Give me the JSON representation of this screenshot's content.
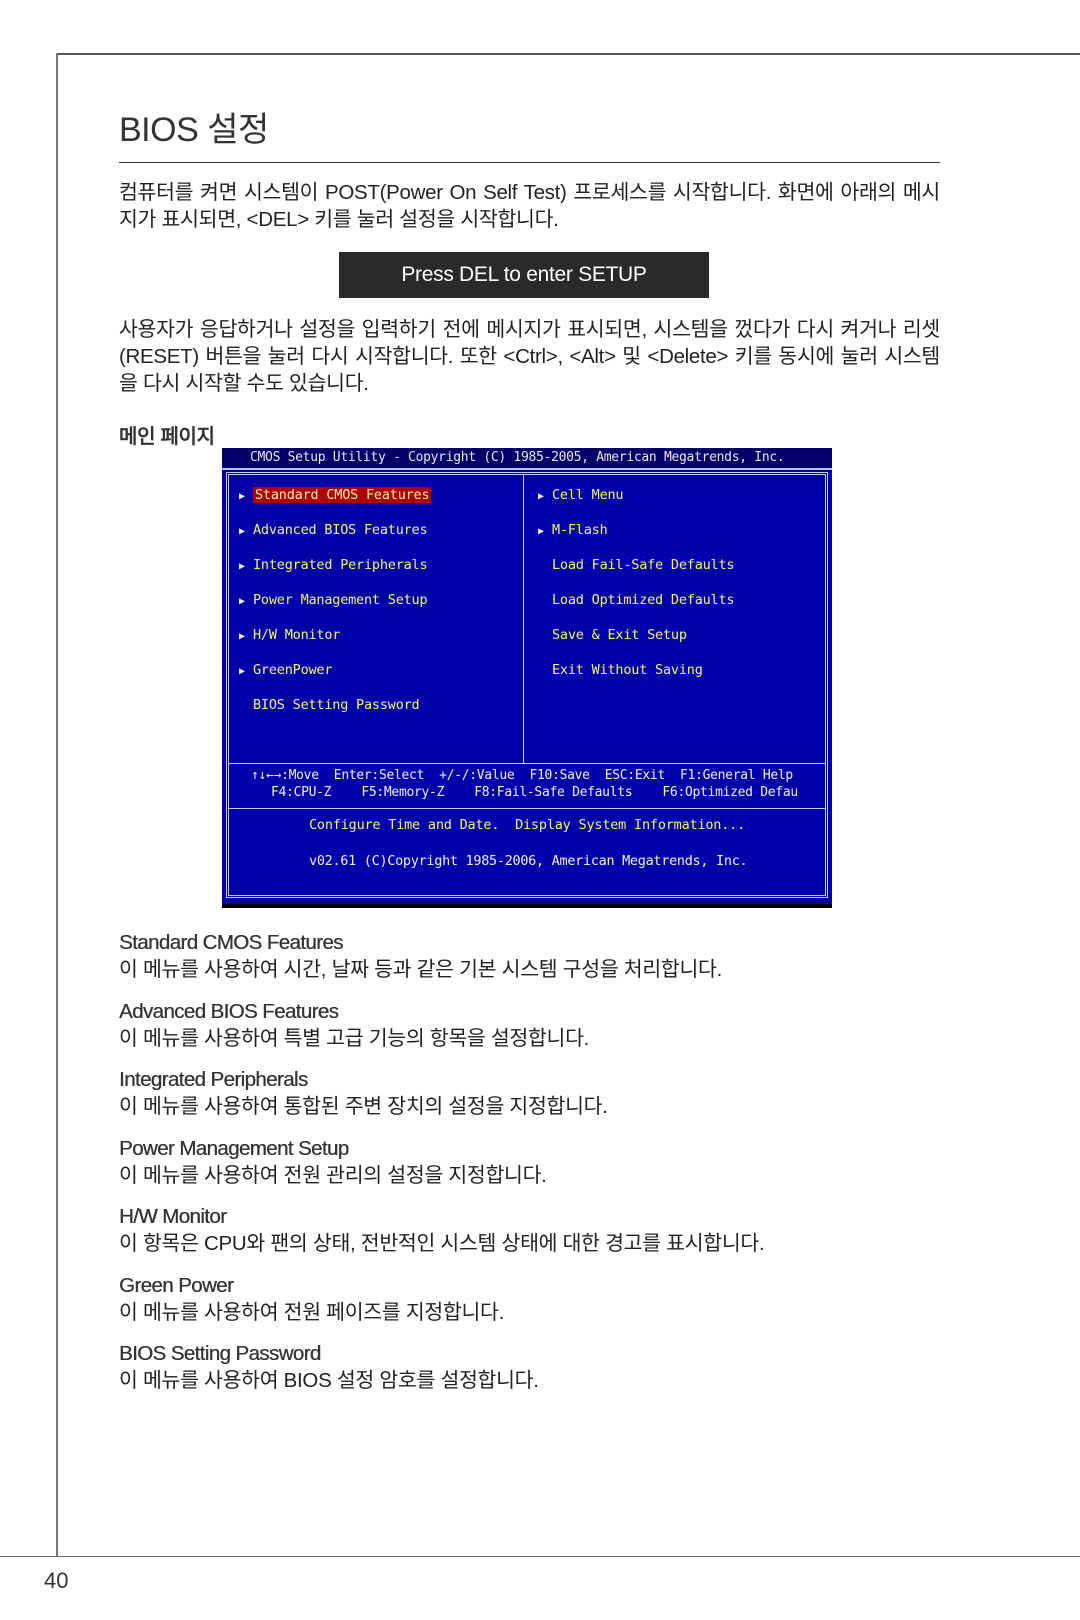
{
  "page": {
    "title": "BIOS 설정",
    "page_number": "40",
    "intro_paragraph": "컴퓨터를 켜면 시스템이 POST(Power On Self Test) 프로세스를 시작합니다. 화면에 아래의 메시지가 표시되면, <DEL> 키를 눌러 설정을 시작합니다.",
    "press_message": "Press DEL to enter SETUP",
    "restart_paragraph": "사용자가 응답하거나 설정을 입력하기 전에 메시지가 표시되면, 시스템을 껐다가 다시 켜거나 리셋(RESET) 버튼을 눌러 다시 시작합니다. 또한 <Ctrl>, <Alt> 및 <Delete> 키를 동시에 눌러 시스템을 다시 시작할 수도 있습니다.",
    "main_page_heading": "메인 페이지"
  },
  "bios": {
    "header": "CMOS Setup Utility - Copyright (C) 1985-2005, American Megatrends, Inc.",
    "colors": {
      "background": "#0000a8",
      "header_bg": "#000068",
      "item_text": "#f4f470",
      "selected_bg": "#b00000",
      "border": "#c8c8ff"
    },
    "left_menu": [
      {
        "label": "Standard CMOS Features",
        "submenu": true,
        "selected": true
      },
      {
        "label": "Advanced BIOS Features",
        "submenu": true,
        "selected": false
      },
      {
        "label": "Integrated Peripherals",
        "submenu": true,
        "selected": false
      },
      {
        "label": "Power Management Setup",
        "submenu": true,
        "selected": false
      },
      {
        "label": "H/W Monitor",
        "submenu": true,
        "selected": false
      },
      {
        "label": "GreenPower",
        "submenu": true,
        "selected": false
      },
      {
        "label": "BIOS Setting Password",
        "submenu": false,
        "selected": false
      }
    ],
    "right_menu": [
      {
        "label": "Cell Menu",
        "submenu": true
      },
      {
        "label": "M-Flash",
        "submenu": true
      },
      {
        "label": "Load Fail-Safe Defaults",
        "submenu": false
      },
      {
        "label": "Load Optimized Defaults",
        "submenu": false
      },
      {
        "label": "Save & Exit Setup",
        "submenu": false
      },
      {
        "label": "Exit Without Saving",
        "submenu": false
      }
    ],
    "arrow_glyph": "▶",
    "help_line_1": "↑↓←→:Move  Enter:Select  +/-/:Value  F10:Save  ESC:Exit  F1:General Help",
    "help_line_2": "F4:CPU-Z    F5:Memory-Z    F8:Fail-Safe Defaults    F6:Optimized Defau",
    "description": "Configure Time and Date.  Display System Information...",
    "version": "v02.61 (C)Copyright 1985-2006, American Megatrends, Inc."
  },
  "descriptions": [
    {
      "title": "Standard CMOS Features",
      "text": "이 메뉴를 사용하여 시간, 날짜 등과 같은 기본 시스템 구성을 처리합니다."
    },
    {
      "title": "Advanced BIOS Features",
      "text": "이 메뉴를 사용하여 특별 고급 기능의 항목을 설정합니다."
    },
    {
      "title": "Integrated Peripherals",
      "text": "이 메뉴를 사용하여 통합된 주변 장치의 설정을 지정합니다."
    },
    {
      "title": "Power Management Setup",
      "text": "이 메뉴를 사용하여 전원 관리의 설정을 지정합니다."
    },
    {
      "title": "H/W Monitor",
      "text": "이 항목은 CPU와 팬의 상태, 전반적인 시스템 상태에 대한 경고를 표시합니다."
    },
    {
      "title": "Green Power",
      "text": "이 메뉴를 사용하여 전원 페이즈를 지정합니다."
    },
    {
      "title": "BIOS Setting Password",
      "text": "이 메뉴를 사용하여 BIOS 설정 암호를 설정합니다."
    }
  ]
}
